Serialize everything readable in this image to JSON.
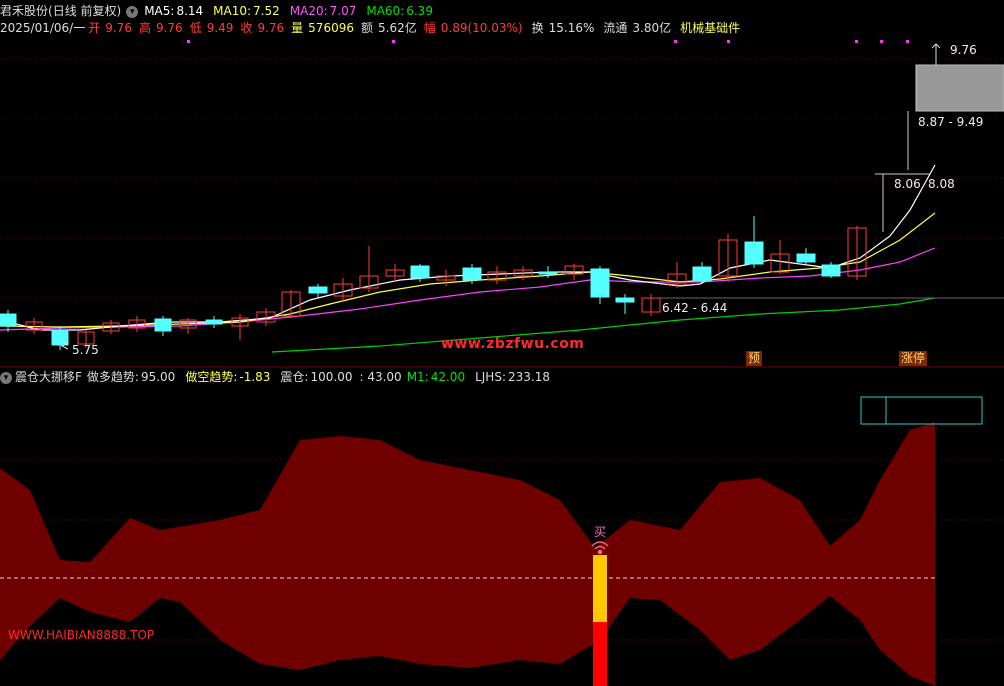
{
  "header": {
    "stock_name": "君禾股份",
    "period": "(日线 前复权)",
    "ma5_label": "MA5:",
    "ma5": "8.14",
    "ma10_label": "MA10:",
    "ma10": "7.52",
    "ma20_label": "MA20:",
    "ma20": "7.07",
    "ma60_label": "MA60:",
    "ma60": "6.39",
    "date": "2025/01/06/一",
    "open_label": "开",
    "open": "9.76",
    "high_label": "高",
    "high": "9.76",
    "low_label": "低",
    "low": "9.49",
    "close_label": "收",
    "close": "9.76",
    "volume_label": "量",
    "volume": "576096",
    "amount_label": "额",
    "amount": "5.62亿",
    "change_label": "幅",
    "change": "0.89(10.03%)",
    "turnover_label": "换",
    "turnover": "15.16%",
    "float_label": "流通",
    "float": "3.80亿",
    "sector": "机械基础件"
  },
  "price_annotations": {
    "max_label": "9.76",
    "box_range": "8.87 - 9.49",
    "left_price": "8.06",
    "right_price": "8.08",
    "mid_range": "6.42 - 6.44",
    "low_label": "5.75",
    "watermark": "www.zbzfwu.com",
    "tag_pre": "预",
    "tag_limit": "涨停"
  },
  "indicator": {
    "name": "震仓大挪移F",
    "long_label": "做多趋势:",
    "long_value": "95.00",
    "short_label": "做空趋势:",
    "short_value": "-1.83",
    "shake_label": "震仓:",
    "shake_value": "100.00",
    "shake_value2": ": 43.00",
    "m1_label": "M1:",
    "m1_value": "42.00",
    "ljhs_label": "LJHS:",
    "ljhs_value": "233.18",
    "buy_label": "买",
    "site_watermark": "WWW.HAIBIAN8888.TOP"
  },
  "colors": {
    "up": "#ff3b3b",
    "down": "#54ffff",
    "ma5": "#ffffff",
    "ma10": "#ffff54",
    "ma20": "#ff54ff",
    "ma60": "#00e000",
    "band": "#6e0000",
    "grid": "#7a0000"
  }
}
